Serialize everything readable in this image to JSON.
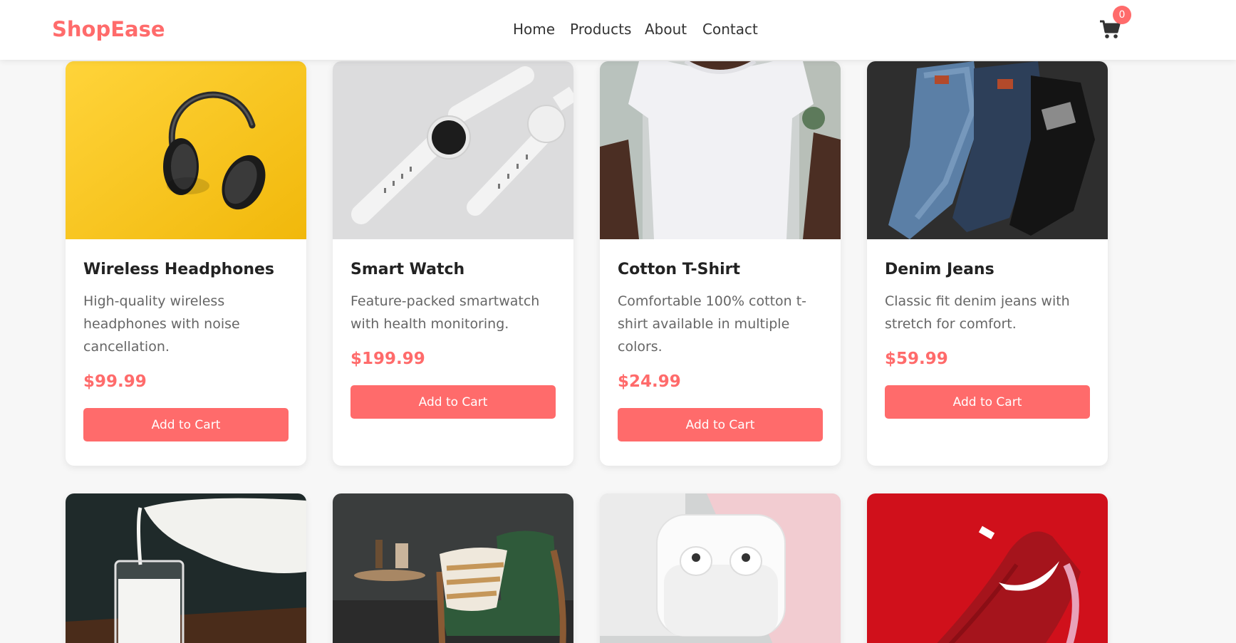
{
  "header": {
    "logo": "ShopEase",
    "nav": [
      "Home",
      "Products",
      "About",
      "Contact"
    ],
    "cart_icon": "shopping-cart-icon",
    "cart_count": "0"
  },
  "colors": {
    "accent": "#ff6b6b",
    "background": "#f7f7f7"
  },
  "products": [
    {
      "name": "Wireless Headphones",
      "description": "High-quality wireless headphones with noise cancellation.",
      "price": "$99.99",
      "button": "Add to Cart",
      "image": "headphones"
    },
    {
      "name": "Smart Watch",
      "description": "Feature-packed smartwatch with health monitoring.",
      "price": "$199.99",
      "button": "Add to Cart",
      "image": "smart-watch"
    },
    {
      "name": "Cotton T-Shirt",
      "description": "Comfortable 100% cotton t-shirt available in multiple colors.",
      "price": "$24.99",
      "button": "Add to Cart",
      "image": "white-t-shirt"
    },
    {
      "name": "Denim Jeans",
      "description": "Classic fit denim jeans with stretch for comfort.",
      "price": "$59.99",
      "button": "Add to Cart",
      "image": "denim-jeans"
    },
    {
      "image": "milk-pouring"
    },
    {
      "image": "green-armchair"
    },
    {
      "image": "wireless-earbuds"
    },
    {
      "image": "red-sneaker"
    }
  ]
}
